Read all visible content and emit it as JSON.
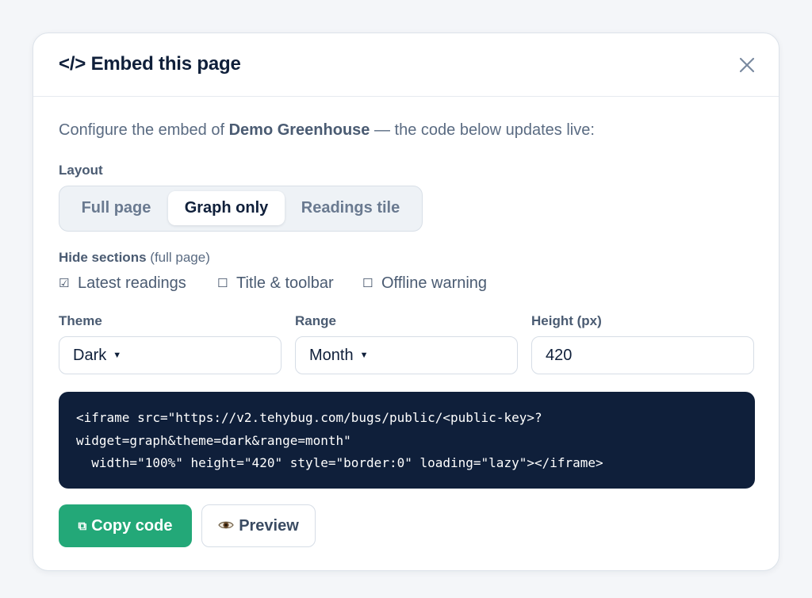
{
  "dialog": {
    "title": "</> Embed this page",
    "close_icon": "close-icon"
  },
  "intro": {
    "prefix": "Configure the embed of ",
    "name": "Demo Greenhouse",
    "suffix": " — the code below updates live:"
  },
  "layout": {
    "label": "Layout",
    "options": [
      "Full page",
      "Graph only",
      "Readings tile"
    ],
    "selected": "Graph only"
  },
  "hide_sections": {
    "label": "Hide sections",
    "note": "(full page)",
    "options": [
      {
        "label": "Latest readings",
        "checked": true
      },
      {
        "label": "Title & toolbar",
        "checked": false
      },
      {
        "label": "Offline warning",
        "checked": false
      }
    ]
  },
  "theme": {
    "label": "Theme",
    "value": "Dark"
  },
  "range": {
    "label": "Range",
    "value": "Month"
  },
  "height": {
    "label": "Height (px)",
    "value": "420"
  },
  "code": {
    "lines": [
      "<iframe src=\"https://v2.tehybug.com/bugs/public/<public-key>?",
      "widget=graph&theme=dark&range=month\"",
      "  width=\"100%\" height=\"420\" style=\"border:0\" loading=\"lazy\"></iframe>"
    ]
  },
  "actions": {
    "copy_label": "Copy code",
    "copy_icon": "copy-icon",
    "preview_label": "Preview",
    "preview_icon": "eye-icon"
  },
  "colors": {
    "primary": "#23a878",
    "code_bg": "#0f1f3a",
    "text_dark": "#0f1f3a",
    "text_muted": "#5a6b82"
  }
}
